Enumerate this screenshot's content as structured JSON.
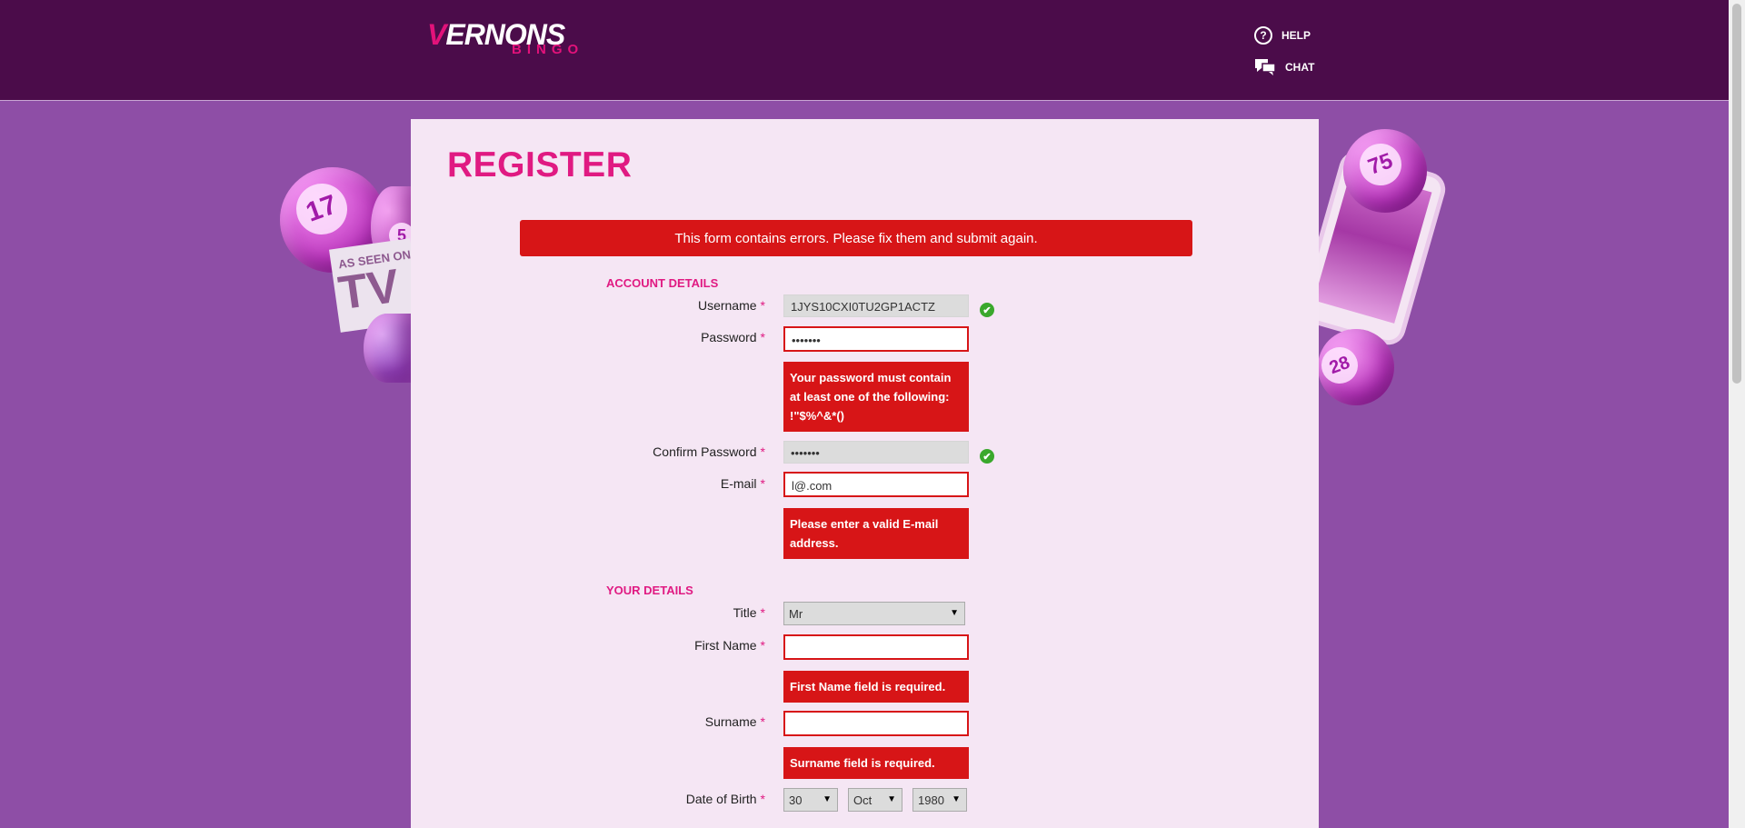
{
  "header": {
    "logo_main_v": "V",
    "logo_main_rest": "ERNONS",
    "logo_sub": "BINGO",
    "help": {
      "icon": "question-circle-icon",
      "label": "HELP"
    },
    "chat": {
      "icon": "chat-bubbles-icon",
      "label": "CHAT"
    }
  },
  "decor": {
    "balls": [
      "17",
      "5",
      "75",
      "28"
    ],
    "tv_sign_small": "AS SEEN ON",
    "tv_sign_big": "TV"
  },
  "form": {
    "title": "REGISTER",
    "error_banner": "This form contains errors. Please fix them and submit again.",
    "account_section": "ACCOUNT DETAILS",
    "your_details_section": "YOUR DETAILS",
    "required_marker": "*",
    "username": {
      "label": "Username",
      "value": "1JYS10CXI0TU2GP1ACTZ"
    },
    "password": {
      "label": "Password",
      "value": "•••••••",
      "error": "Your password must contain at least one of the following: !\"$%^&*()"
    },
    "confirm_password": {
      "label": "Confirm Password",
      "value": "•••••••"
    },
    "email": {
      "label": "E-mail",
      "value": "l@.com",
      "error": "Please enter a valid E-mail address."
    },
    "title_field": {
      "label": "Title",
      "value": "Mr"
    },
    "first_name": {
      "label": "First Name",
      "value": "",
      "error": "First Name field is required."
    },
    "surname": {
      "label": "Surname",
      "value": "",
      "error": "Surname field is required."
    },
    "dob": {
      "label": "Date of Birth",
      "day": "30",
      "month": "Oct",
      "year": "1980"
    },
    "valid_mark": "✔"
  },
  "colors": {
    "header_bg": "#4b0c4a",
    "page_bg": "#8e4ea6",
    "panel_bg": "#f5e6f4",
    "accent": "#e01a82",
    "error": "#d71517",
    "valid": "#3aa82c"
  }
}
